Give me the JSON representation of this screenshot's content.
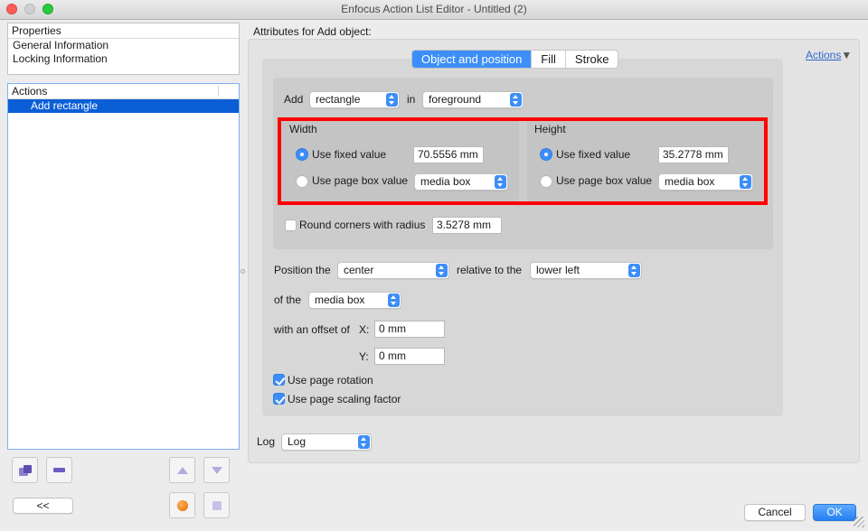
{
  "window": {
    "title": "Enfocus Action List Editor - Untitled (2)"
  },
  "properties": {
    "header": "Properties",
    "items": [
      "General Information",
      "Locking Information"
    ]
  },
  "actions_list": {
    "header": "Actions",
    "items": [
      "Add rectangle"
    ]
  },
  "left_buttons": {
    "collapse_label": "<<"
  },
  "main": {
    "attributes_label": "Attributes for Add object:",
    "actions_link": "Actions",
    "tabs": [
      "Object and position",
      "Fill",
      "Stroke"
    ],
    "add": {
      "label": "Add",
      "shape": "rectangle",
      "in_label": "in",
      "layer": "foreground"
    },
    "width": {
      "title": "Width",
      "fixed_label": "Use fixed value",
      "fixed_value": "70.5556 mm",
      "pagebox_label": "Use page box value",
      "pagebox_value": "media box"
    },
    "height": {
      "title": "Height",
      "fixed_label": "Use fixed value",
      "fixed_value": "35.2778 mm",
      "pagebox_label": "Use page box value",
      "pagebox_value": "media box"
    },
    "round_corners": {
      "label": "Round corners with radius",
      "value": "3.5278 mm"
    },
    "position": {
      "label": "Position the",
      "anchor": "center",
      "relative_label": "relative to the",
      "relative_value": "lower left",
      "of_label": "of the",
      "of_value": "media box",
      "offset_label": "with an offset of",
      "x_label": "X:",
      "x_value": "0 mm",
      "y_label": "Y:",
      "y_value": "0 mm"
    },
    "options": {
      "page_rotation": "Use page rotation",
      "page_scaling": "Use page scaling factor"
    },
    "log": {
      "label": "Log",
      "value": "Log"
    }
  },
  "footer": {
    "cancel_label": "Cancel",
    "ok_label": "OK"
  },
  "colors": {
    "accent": "#3d8ef8",
    "selection": "#0a5fd6",
    "highlight": "#ff0000"
  }
}
